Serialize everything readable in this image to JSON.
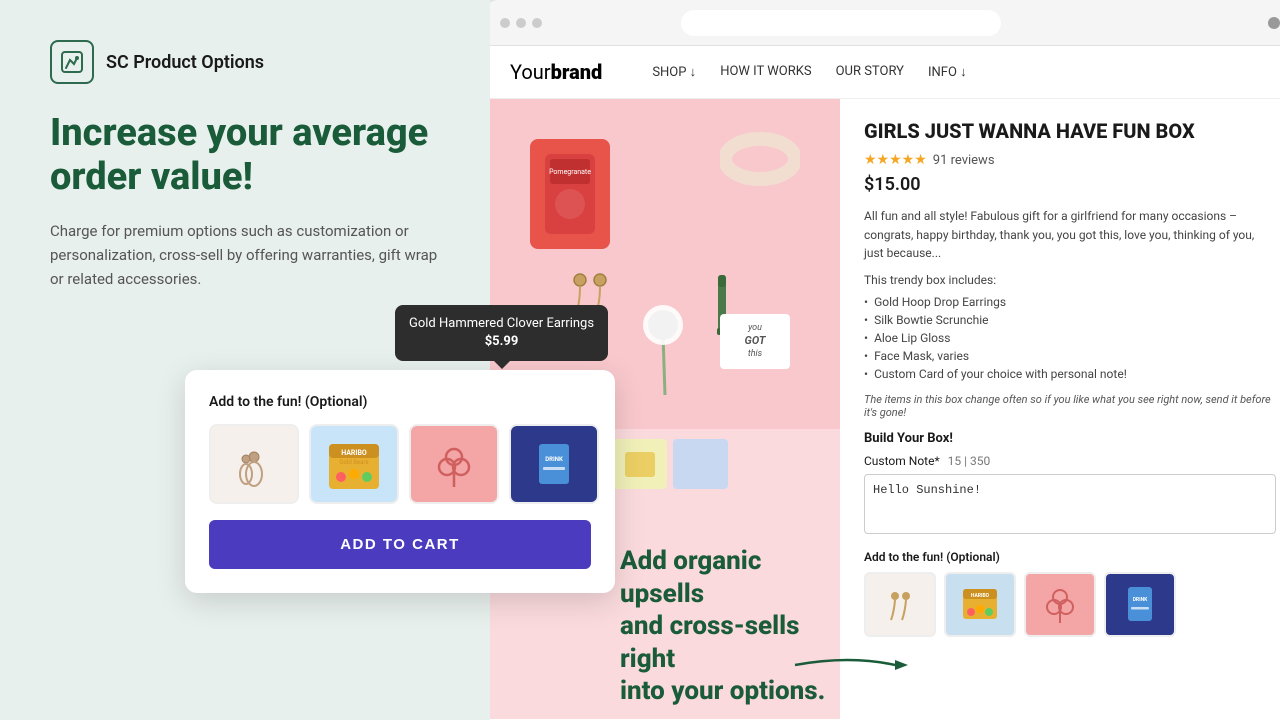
{
  "app": {
    "logo_icon": "↗",
    "logo_name": "SC Product Options"
  },
  "left": {
    "headline": "Increase your average order value!",
    "subtext": "Charge for premium options such as customization or personalization, cross-sell by offering warranties, gift wrap or related accessories."
  },
  "tooltip": {
    "name": "Gold Hammered Clover Earrings",
    "price": "$5.99"
  },
  "floating_card": {
    "title": "Add to the fun! (Optional)",
    "add_to_cart": "ADD TO CART"
  },
  "upsell": {
    "line1": "Add organic upsells",
    "line2": "and cross-sells right",
    "line3": "into your options."
  },
  "browser": {
    "brand": "Your",
    "brand_bold": "brand",
    "nav": [
      "SHOP ↓",
      "HOW IT WORKS",
      "OUR STORY",
      "INFO ↓"
    ]
  },
  "product": {
    "title": "GIRLS JUST WANNA HAVE FUN BOX",
    "stars": "★★★★★",
    "reviews": "91 reviews",
    "price": "$15.00",
    "description": "All fun and all style! Fabulous gift for a girlfriend for many occasions – congrats, happy birthday, thank you, you got this, love you, thinking of you, just because...",
    "includes_title": "This trendy box includes:",
    "includes": [
      "Gold Hoop Drop Earrings",
      "Silk Bowtie Scrunchie",
      "Aloe Lip Gloss",
      "Face Mask, varies",
      "Custom Card of your choice with personal note!"
    ],
    "italic_note": "The items in this box change often so if you like what you see right now, send it before it's gone!",
    "build_title": "Build Your Box!",
    "custom_note_label": "Custom Note*",
    "char_count": "15 | 350",
    "custom_note_value": "Hello Sunshine!",
    "add_fun_title": "Add to the fun! (Optional)"
  }
}
